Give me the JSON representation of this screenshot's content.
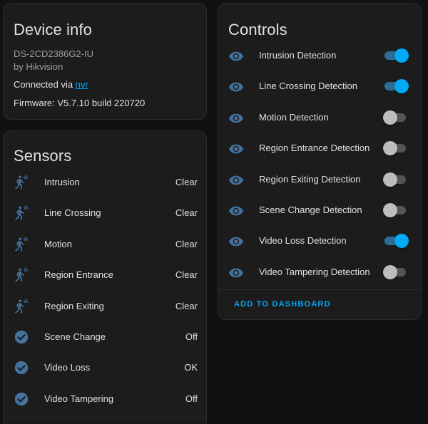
{
  "device": {
    "title": "Device info",
    "model": "DS-2CD2386G2-IU",
    "manufacturer": "by Hikvision",
    "connected_prefix": "Connected via ",
    "connected_link": "nvr",
    "firmware": "Firmware: V5.7.10 build 220720"
  },
  "sensors": {
    "title": "Sensors",
    "items": [
      {
        "name": "Intrusion",
        "state": "Clear",
        "icon": "motion-sensor-icon"
      },
      {
        "name": "Line Crossing",
        "state": "Clear",
        "icon": "motion-sensor-icon"
      },
      {
        "name": "Motion",
        "state": "Clear",
        "icon": "motion-sensor-icon"
      },
      {
        "name": "Region Entrance",
        "state": "Clear",
        "icon": "motion-sensor-icon"
      },
      {
        "name": "Region Exiting",
        "state": "Clear",
        "icon": "motion-sensor-icon"
      },
      {
        "name": "Scene Change",
        "state": "Off",
        "icon": "check-circle-icon"
      },
      {
        "name": "Video Loss",
        "state": "OK",
        "icon": "check-circle-icon"
      },
      {
        "name": "Video Tampering",
        "state": "Off",
        "icon": "check-circle-icon"
      }
    ]
  },
  "controls": {
    "title": "Controls",
    "items": [
      {
        "name": "Intrusion Detection",
        "on": true,
        "icon": "eye-icon"
      },
      {
        "name": "Line Crossing Detection",
        "on": true,
        "icon": "eye-icon"
      },
      {
        "name": "Motion Detection",
        "on": false,
        "icon": "eye-icon"
      },
      {
        "name": "Region Entrance Detection",
        "on": false,
        "icon": "eye-icon"
      },
      {
        "name": "Region Exiting Detection",
        "on": false,
        "icon": "eye-icon"
      },
      {
        "name": "Scene Change Detection",
        "on": false,
        "icon": "eye-icon"
      },
      {
        "name": "Video Loss Detection",
        "on": true,
        "icon": "eye-icon"
      },
      {
        "name": "Video Tampering Detection",
        "on": false,
        "icon": "eye-icon"
      }
    ],
    "add_button": "ADD TO DASHBOARD"
  },
  "colors": {
    "accent": "#03a9f4",
    "icon": "#44739e",
    "card": "#1c1c1c",
    "background": "#111111"
  }
}
